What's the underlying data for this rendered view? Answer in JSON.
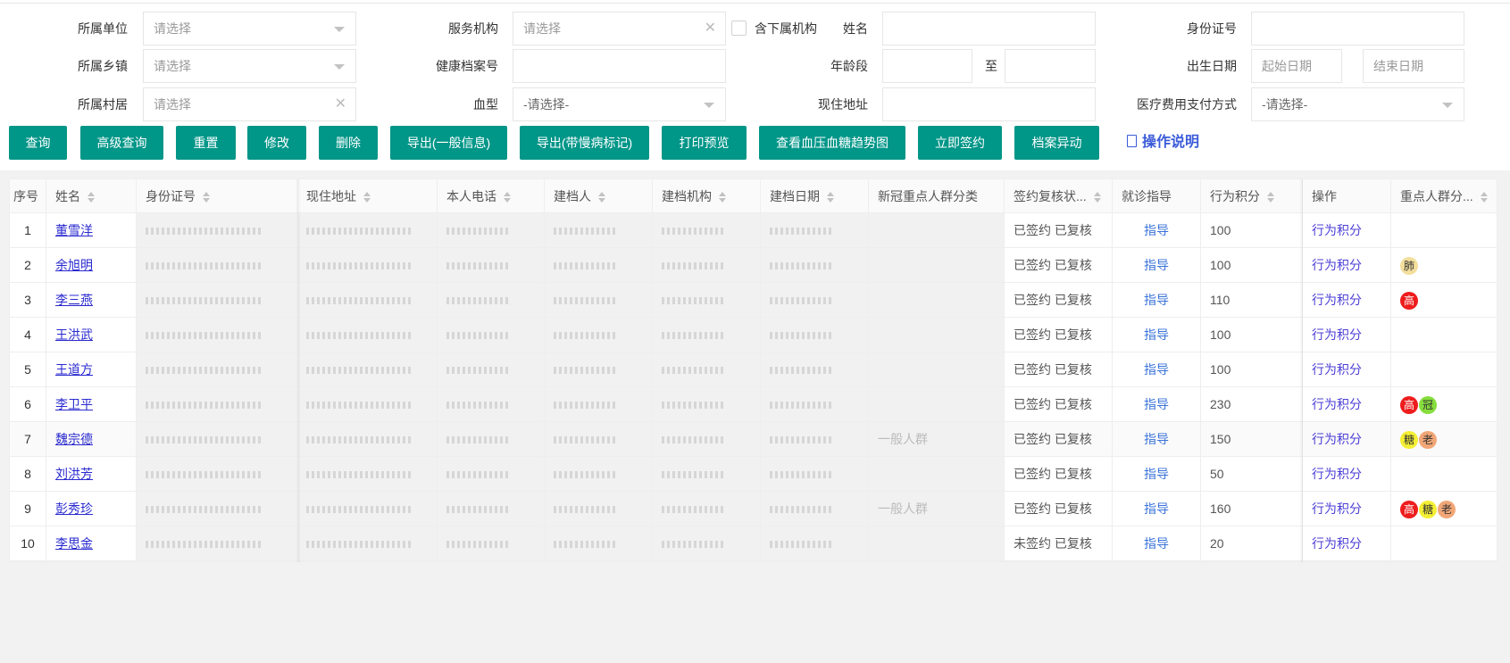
{
  "form": {
    "unit": {
      "label": "所属单位",
      "placeholder": "请选择"
    },
    "service_org": {
      "label": "服务机构",
      "placeholder": "请选择"
    },
    "include_sub": {
      "label": "含下属机构",
      "checked": false
    },
    "name": {
      "label": "姓名",
      "value": ""
    },
    "id_no": {
      "label": "身份证号",
      "value": ""
    },
    "town": {
      "label": "所属乡镇",
      "placeholder": "请选择"
    },
    "record_no": {
      "label": "健康档案号",
      "value": ""
    },
    "age": {
      "label": "年龄段",
      "to": "至"
    },
    "birth": {
      "label": "出生日期",
      "start_placeholder": "起始日期",
      "end_placeholder": "结束日期"
    },
    "village": {
      "label": "所属村居",
      "placeholder": "请选择"
    },
    "blood": {
      "label": "血型",
      "placeholder": "-请选择-"
    },
    "address": {
      "label": "现住地址",
      "value": ""
    },
    "payment": {
      "label": "医疗费用支付方式",
      "placeholder": "-请选择-"
    }
  },
  "buttons": [
    "查询",
    "高级查询",
    "重置",
    "修改",
    "删除",
    "导出(一般信息)",
    "导出(带慢病标记)",
    "打印预览",
    "查看血压血糖趋势图",
    "立即签约",
    "档案异动"
  ],
  "help_label": "操作说明",
  "table": {
    "headers": [
      "序号",
      "姓名",
      "身份证号",
      "现住地址",
      "本人电话",
      "建档人",
      "建档机构",
      "建档日期",
      "新冠重点人群分类",
      "签约复核状...",
      "就诊指导",
      "行为积分",
      "操作",
      "重点人群分..."
    ],
    "rows": [
      {
        "no": "1",
        "name": "董雪洋",
        "covid": "",
        "status": "已签约 已复核",
        "guide": "指导",
        "score": "100",
        "action": "行为积分",
        "tags": []
      },
      {
        "no": "2",
        "name": "余旭明",
        "covid": "",
        "status": "已签约 已复核",
        "guide": "指导",
        "score": "100",
        "action": "行为积分",
        "tags": [
          "肺"
        ]
      },
      {
        "no": "3",
        "name": "李三燕",
        "covid": "",
        "status": "已签约 已复核",
        "guide": "指导",
        "score": "110",
        "action": "行为积分",
        "tags": [
          "高"
        ]
      },
      {
        "no": "4",
        "name": "王洪武",
        "covid": "",
        "status": "已签约 已复核",
        "guide": "指导",
        "score": "100",
        "action": "行为积分",
        "tags": []
      },
      {
        "no": "5",
        "name": "王道方",
        "covid": "",
        "status": "已签约 已复核",
        "guide": "指导",
        "score": "100",
        "action": "行为积分",
        "tags": []
      },
      {
        "no": "6",
        "name": "李卫平",
        "covid": "",
        "status": "已签约 已复核",
        "guide": "指导",
        "score": "230",
        "action": "行为积分",
        "tags": [
          "高",
          "冠"
        ]
      },
      {
        "no": "7",
        "name": "魏宗德",
        "covid": "一般人群",
        "status": "已签约 已复核",
        "guide": "指导",
        "score": "150",
        "action": "行为积分",
        "tags": [
          "糖",
          "老"
        ]
      },
      {
        "no": "8",
        "name": "刘洪芳",
        "covid": "",
        "status": "已签约 已复核",
        "guide": "指导",
        "score": "50",
        "action": "行为积分",
        "tags": []
      },
      {
        "no": "9",
        "name": "彭秀珍",
        "covid": "一般人群",
        "status": "已签约 已复核",
        "guide": "指导",
        "score": "160",
        "action": "行为积分",
        "tags": [
          "高",
          "糖",
          "老"
        ]
      },
      {
        "no": "10",
        "name": "李思金",
        "covid": "",
        "status": "未签约 已复核",
        "guide": "指导",
        "score": "20",
        "action": "行为积分",
        "tags": []
      }
    ]
  },
  "tag_colors": {
    "肺": "#f3df9c",
    "高": "#ee1d1d",
    "冠": "#86dd3c",
    "糖": "#f4ef33",
    "老": "#f1a677"
  },
  "accent": "#009688"
}
